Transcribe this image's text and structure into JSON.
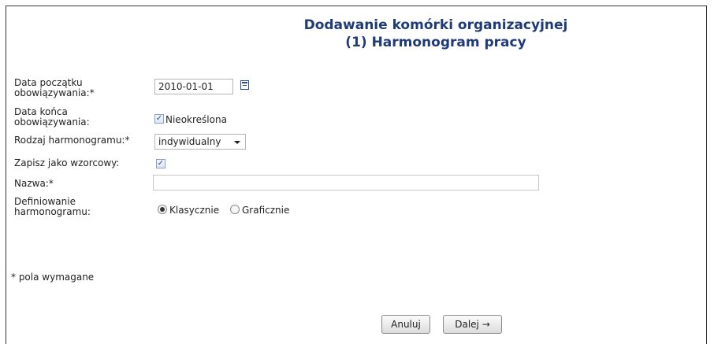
{
  "title": {
    "line1": "Dodawanie komórki organizacyjnej",
    "line2": "(1) Harmonogram pracy"
  },
  "form": {
    "start_date_label_1": "Data początku",
    "start_date_label_2": "obowiązywania:*",
    "start_date_value": "2010-01-01",
    "end_date_label_1": "Data końca",
    "end_date_label_2": "obowiązywania:",
    "end_date_checkbox_label": "Nieokreślona",
    "end_date_checked": true,
    "schedule_type_label": "Rodzaj harmonogramu:*",
    "schedule_type_value": "indywidualny",
    "save_template_label": "Zapisz jako wzorcowy:",
    "save_template_checked": true,
    "name_label": "Nazwa:*",
    "name_value": "",
    "definition_label_1": "Definiowanie",
    "definition_label_2": "harmonogramu:",
    "definition_options": [
      "Klasycznie",
      "Graficznie"
    ],
    "definition_selected": "Klasycznie"
  },
  "footnote": "* pola wymagane",
  "buttons": {
    "cancel": "Anuluj",
    "next": "Dalej →"
  },
  "icons": {
    "calendar": "calendar-icon",
    "checkmark": "✓",
    "dropdown": "chevron-down-icon"
  }
}
